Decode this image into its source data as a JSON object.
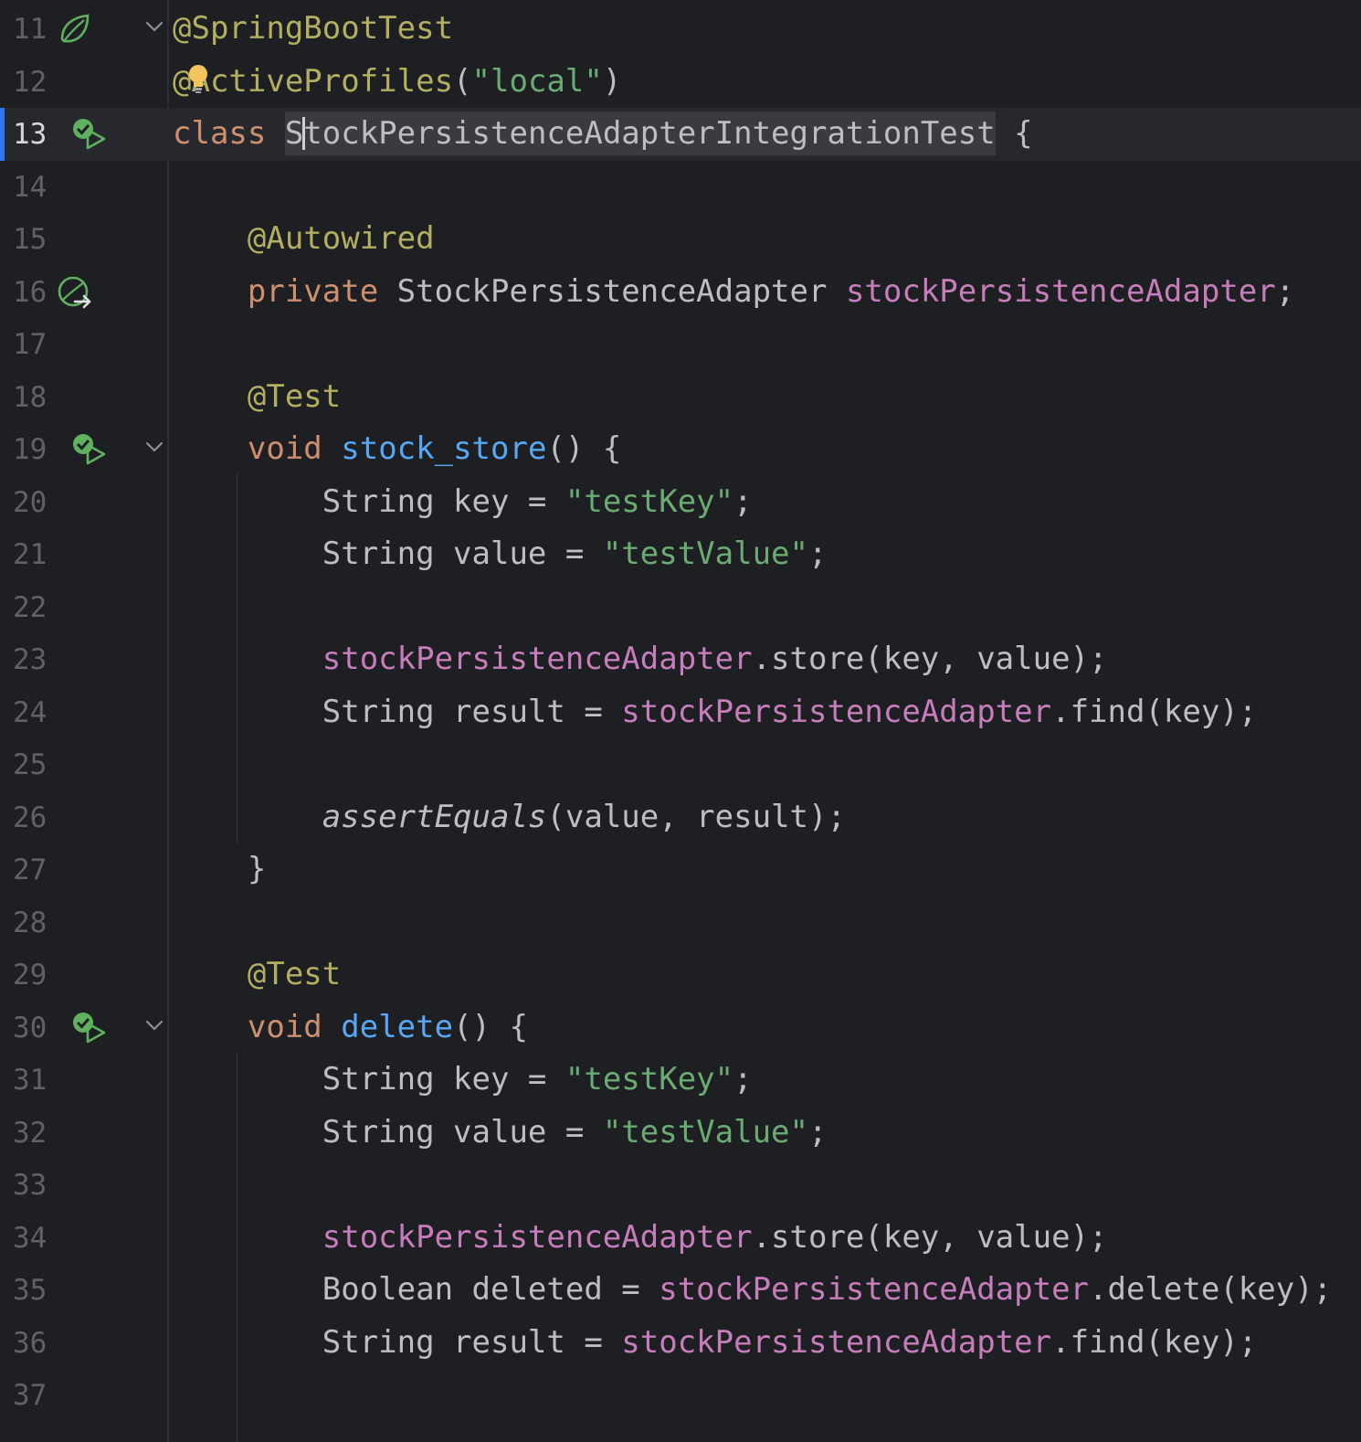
{
  "editor": {
    "current_line": 13,
    "lines": [
      {
        "no": "11",
        "segments": [
          {
            "t": "@SpringBootTest",
            "c": "ann"
          }
        ],
        "icon": "spring-bean-leaf-icon",
        "fold": true
      },
      {
        "no": "12",
        "segments": [
          {
            "t": "@ActiveProfiles",
            "c": "ann"
          },
          {
            "t": "(",
            "c": ""
          },
          {
            "t": "\"local\"",
            "c": "str"
          },
          {
            "t": ")",
            "c": ""
          }
        ],
        "icon": "",
        "fold": false
      },
      {
        "no": "13",
        "segments": [
          {
            "t": "class ",
            "c": "kw"
          },
          {
            "t": "StockPersistenceAdapterIntegrationTest",
            "c": "hl"
          },
          {
            "t": " {",
            "c": ""
          }
        ],
        "icon": "run-test-passed-icon",
        "fold": false
      },
      {
        "no": "14",
        "segments": [],
        "icon": "",
        "fold": false
      },
      {
        "no": "15",
        "segments": [
          {
            "t": "    ",
            "c": ""
          },
          {
            "t": "@Autowired",
            "c": "ann"
          }
        ],
        "icon": "",
        "fold": false
      },
      {
        "no": "16",
        "segments": [
          {
            "t": "    ",
            "c": ""
          },
          {
            "t": "private ",
            "c": "kw"
          },
          {
            "t": "StockPersistenceAdapter ",
            "c": ""
          },
          {
            "t": "stockPersistenceAdapter",
            "c": "fld"
          },
          {
            "t": ";",
            "c": ""
          }
        ],
        "icon": "bean-navigate-icon",
        "fold": false
      },
      {
        "no": "17",
        "segments": [],
        "icon": "",
        "fold": false
      },
      {
        "no": "18",
        "segments": [
          {
            "t": "    ",
            "c": ""
          },
          {
            "t": "@Test",
            "c": "ann"
          }
        ],
        "icon": "",
        "fold": false
      },
      {
        "no": "19",
        "segments": [
          {
            "t": "    ",
            "c": ""
          },
          {
            "t": "void ",
            "c": "kw"
          },
          {
            "t": "stock_store",
            "c": "fn"
          },
          {
            "t": "() {",
            "c": ""
          }
        ],
        "icon": "run-test-passed-icon",
        "fold": true
      },
      {
        "no": "20",
        "segments": [
          {
            "t": "        String key = ",
            "c": ""
          },
          {
            "t": "\"testKey\"",
            "c": "str"
          },
          {
            "t": ";",
            "c": ""
          }
        ],
        "icon": "",
        "fold": false
      },
      {
        "no": "21",
        "segments": [
          {
            "t": "        String value = ",
            "c": ""
          },
          {
            "t": "\"testValue\"",
            "c": "str"
          },
          {
            "t": ";",
            "c": ""
          }
        ],
        "icon": "",
        "fold": false
      },
      {
        "no": "22",
        "segments": [],
        "icon": "",
        "fold": false
      },
      {
        "no": "23",
        "segments": [
          {
            "t": "        ",
            "c": ""
          },
          {
            "t": "stockPersistenceAdapter",
            "c": "fld"
          },
          {
            "t": ".store(key, value);",
            "c": ""
          }
        ],
        "icon": "",
        "fold": false
      },
      {
        "no": "24",
        "segments": [
          {
            "t": "        String result = ",
            "c": ""
          },
          {
            "t": "stockPersistenceAdapter",
            "c": "fld"
          },
          {
            "t": ".find(key);",
            "c": ""
          }
        ],
        "icon": "",
        "fold": false
      },
      {
        "no": "25",
        "segments": [],
        "icon": "",
        "fold": false
      },
      {
        "no": "26",
        "segments": [
          {
            "t": "        ",
            "c": ""
          },
          {
            "t": "assertEquals",
            "c": "it"
          },
          {
            "t": "(value, result);",
            "c": ""
          }
        ],
        "icon": "",
        "fold": false
      },
      {
        "no": "27",
        "segments": [
          {
            "t": "    }",
            "c": ""
          }
        ],
        "icon": "",
        "fold": false
      },
      {
        "no": "28",
        "segments": [],
        "icon": "",
        "fold": false
      },
      {
        "no": "29",
        "segments": [
          {
            "t": "    ",
            "c": ""
          },
          {
            "t": "@Test",
            "c": "ann"
          }
        ],
        "icon": "",
        "fold": false
      },
      {
        "no": "30",
        "segments": [
          {
            "t": "    ",
            "c": ""
          },
          {
            "t": "void ",
            "c": "kw"
          },
          {
            "t": "delete",
            "c": "fn"
          },
          {
            "t": "() {",
            "c": ""
          }
        ],
        "icon": "run-test-passed-icon",
        "fold": true
      },
      {
        "no": "31",
        "segments": [
          {
            "t": "        String key = ",
            "c": ""
          },
          {
            "t": "\"testKey\"",
            "c": "str"
          },
          {
            "t": ";",
            "c": ""
          }
        ],
        "icon": "",
        "fold": false
      },
      {
        "no": "32",
        "segments": [
          {
            "t": "        String value = ",
            "c": ""
          },
          {
            "t": "\"testValue\"",
            "c": "str"
          },
          {
            "t": ";",
            "c": ""
          }
        ],
        "icon": "",
        "fold": false
      },
      {
        "no": "33",
        "segments": [],
        "icon": "",
        "fold": false
      },
      {
        "no": "34",
        "segments": [
          {
            "t": "        ",
            "c": ""
          },
          {
            "t": "stockPersistenceAdapter",
            "c": "fld"
          },
          {
            "t": ".store(key, value);",
            "c": ""
          }
        ],
        "icon": "",
        "fold": false
      },
      {
        "no": "35",
        "segments": [
          {
            "t": "        Boolean deleted = ",
            "c": ""
          },
          {
            "t": "stockPersistenceAdapter",
            "c": "fld"
          },
          {
            "t": ".delete(key);",
            "c": ""
          }
        ],
        "icon": "",
        "fold": false
      },
      {
        "no": "36",
        "segments": [
          {
            "t": "        String result = ",
            "c": ""
          },
          {
            "t": "stockPersistenceAdapter",
            "c": "fld"
          },
          {
            "t": ".find(key);",
            "c": ""
          }
        ],
        "icon": "",
        "fold": false
      },
      {
        "no": "37",
        "segments": [],
        "icon": "",
        "fold": false
      }
    ]
  },
  "colors": {
    "background": "#1e1f22",
    "keyword": "#cf8e6d",
    "annotation": "#b3ae60",
    "string": "#6aab73",
    "field": "#c77dbb",
    "method": "#56a8f5",
    "text": "#bcbec4",
    "line_number": "#5e6168",
    "caret_line_marker": "#3574f0"
  }
}
